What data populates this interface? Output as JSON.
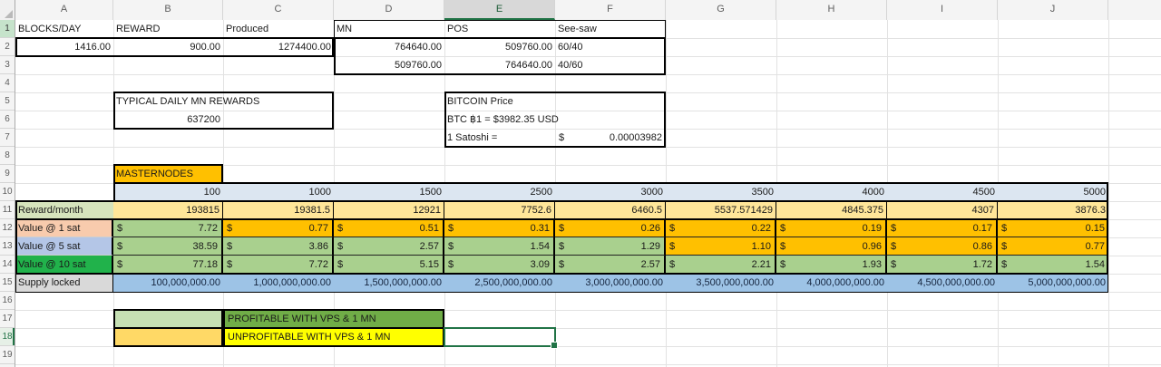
{
  "sheet": {
    "col_headers": [
      "A",
      "B",
      "C",
      "D",
      "E",
      "F",
      "G",
      "H",
      "I",
      "J"
    ],
    "row_headers": [
      "1",
      "2",
      "3",
      "4",
      "5",
      "6",
      "7",
      "8",
      "9",
      "10",
      "11",
      "12",
      "13",
      "14",
      "15",
      "16",
      "17",
      "18",
      "19"
    ],
    "active_cell": "E18",
    "selected_column": "E",
    "selected_row": "18"
  },
  "top_table": {
    "headers": {
      "blocks": "BLOCKS/DAY",
      "reward": "REWARD",
      "produced": "Produced",
      "mn": "MN",
      "pos": "POS",
      "seesaw": "See-saw"
    },
    "row2": {
      "blocks": "1416.00",
      "reward": "900.00",
      "produced": "1274400.00",
      "mn": "764640.00",
      "pos": "509760.00",
      "seesaw": "60/40"
    },
    "row3": {
      "mn": "509760.00",
      "pos": "764640.00",
      "seesaw": "40/60"
    }
  },
  "mn_rewards": {
    "title": "TYPICAL DAILY MN REWARDS",
    "value": "637200"
  },
  "bitcoin": {
    "title": "BITCOIN Price",
    "rate_line": "BTC ฿1 = $3982.35 USD",
    "satoshi_label": "1 Satoshi =",
    "currency": "$",
    "satoshi_value": "0.00003982"
  },
  "grid": {
    "section_title": "MASTERNODES",
    "currency": "$",
    "node_counts": [
      "100",
      "1000",
      "1500",
      "2500",
      "3000",
      "3500",
      "4000",
      "4500",
      "5000"
    ],
    "reward_row": {
      "label": "Reward/month",
      "values": [
        "193815",
        "19381.5",
        "12921",
        "7752.6",
        "6460.5",
        "5537.571429",
        "4845.375",
        "4307",
        "3876.3"
      ]
    },
    "money_rows": [
      {
        "label": "Value @ 1 sat",
        "values": [
          "7.72",
          "0.77",
          "0.51",
          "0.31",
          "0.26",
          "0.22",
          "0.19",
          "0.17",
          "0.15"
        ],
        "statuses": [
          "green",
          "orange",
          "orange",
          "orange",
          "orange",
          "orange",
          "orange",
          "orange",
          "orange"
        ]
      },
      {
        "label": "Value @ 5 sat",
        "values": [
          "38.59",
          "3.86",
          "2.57",
          "1.54",
          "1.29",
          "1.10",
          "0.96",
          "0.86",
          "0.77"
        ],
        "statuses": [
          "green",
          "green",
          "green",
          "green",
          "green",
          "orange",
          "orange",
          "orange",
          "orange"
        ]
      },
      {
        "label": "Value @ 10 sat",
        "values": [
          "77.18",
          "7.72",
          "5.15",
          "3.09",
          "2.57",
          "2.21",
          "1.93",
          "1.72",
          "1.54"
        ],
        "statuses": [
          "green",
          "green",
          "green",
          "green",
          "green",
          "green",
          "green",
          "green",
          "green"
        ]
      }
    ],
    "supply_row": {
      "label": "Supply locked",
      "values": [
        "100,000,000.00",
        "1,000,000,000.00",
        "1,500,000,000.00",
        "2,500,000,000.00",
        "3,000,000,000.00",
        "3,500,000,000.00",
        "4,000,000,000.00",
        "4,500,000,000.00",
        "5,000,000,000.00"
      ]
    }
  },
  "legend": {
    "profitable": "PROFITABLE WITH VPS & 1 MN",
    "unprofitable": "UNPROFITABLE WITH VPS & 1 MN"
  },
  "colors": {
    "accent_green": "#217346",
    "profitable_green": "#A9D08E",
    "unprofitable_orange": "#FFC000",
    "node_header_blue": "#DCE6F1",
    "reward_tan": "#FFE699",
    "supply_blue": "#9DC3E6",
    "label_reward_green": "#D6E4BC",
    "label_1sat_peach": "#F8CBAD",
    "label_5sat_blue": "#B4C6E7",
    "label_10sat_green": "#21B24B",
    "label_supply_gray": "#D9D9D9",
    "masternodes_orange": "#FFC000",
    "legend_profitable_fill": "#70AD47",
    "legend_profitable_swatch": "#C6E0B4",
    "legend_unprofitable_fill": "#FFFF00",
    "legend_unprofitable_swatch": "#FFD966"
  }
}
